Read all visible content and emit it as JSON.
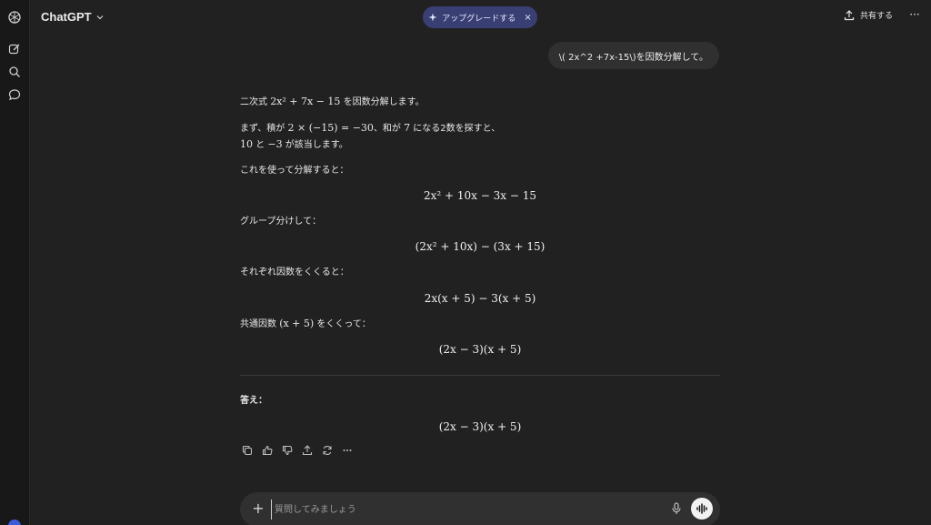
{
  "app": {
    "model_label": "ChatGPT"
  },
  "header": {
    "upgrade_label": "アップグレードする",
    "upgrade_close": "×",
    "share_label": "共有する",
    "more_label": "···"
  },
  "sidebar": {
    "items": [
      {
        "icon": "openai-logo-icon"
      },
      {
        "icon": "new-chat-icon"
      },
      {
        "icon": "search-icon"
      },
      {
        "icon": "chat-bubble-icon"
      }
    ]
  },
  "conversation": {
    "user_message": "\\( 2x^2 +7x-15\\)を因数分解して。",
    "assistant": {
      "intro_prefix": "二次式 ",
      "intro_expr": "2x² + 7x − 15",
      "intro_suffix": " を因数分解します。",
      "step1_prefix": "まず、積が ",
      "step1_expr1": "2 × (−15) = −30",
      "step1_mid": "、和が ",
      "step1_expr2": "7",
      "step1_suffix": " になる2数を探すと、",
      "step1b_expr1": "10",
      "step1b_mid": " と ",
      "step1b_expr2": "−3",
      "step1b_suffix": " が該当します。",
      "step2": "これを使って分解すると：",
      "eq1": "2x² + 10x − 3x − 15",
      "step3": "グループ分けして：",
      "eq2": "(2x² + 10x) − (3x + 15)",
      "step4": "それぞれ因数をくくると：",
      "eq3": "2x(x + 5) − 3(x + 5)",
      "step5_prefix": "共通因数 ",
      "step5_expr": "(x + 5)",
      "step5_suffix": " をくくって：",
      "eq4": "(2x − 3)(x + 5)",
      "answer_label": "答え：",
      "answer_eq": "(2x − 3)(x + 5)"
    }
  },
  "actions": [
    "copy-icon",
    "thumbs-up-icon",
    "thumbs-down-icon",
    "share-icon",
    "regenerate-icon",
    "more-icon"
  ],
  "composer": {
    "plus_label": "+",
    "placeholder": "質問してみましょう"
  },
  "colors": {
    "background": "#212121",
    "sidebar": "#181818",
    "bubble": "#303030",
    "upgrade_pill": "#3a3f73"
  }
}
